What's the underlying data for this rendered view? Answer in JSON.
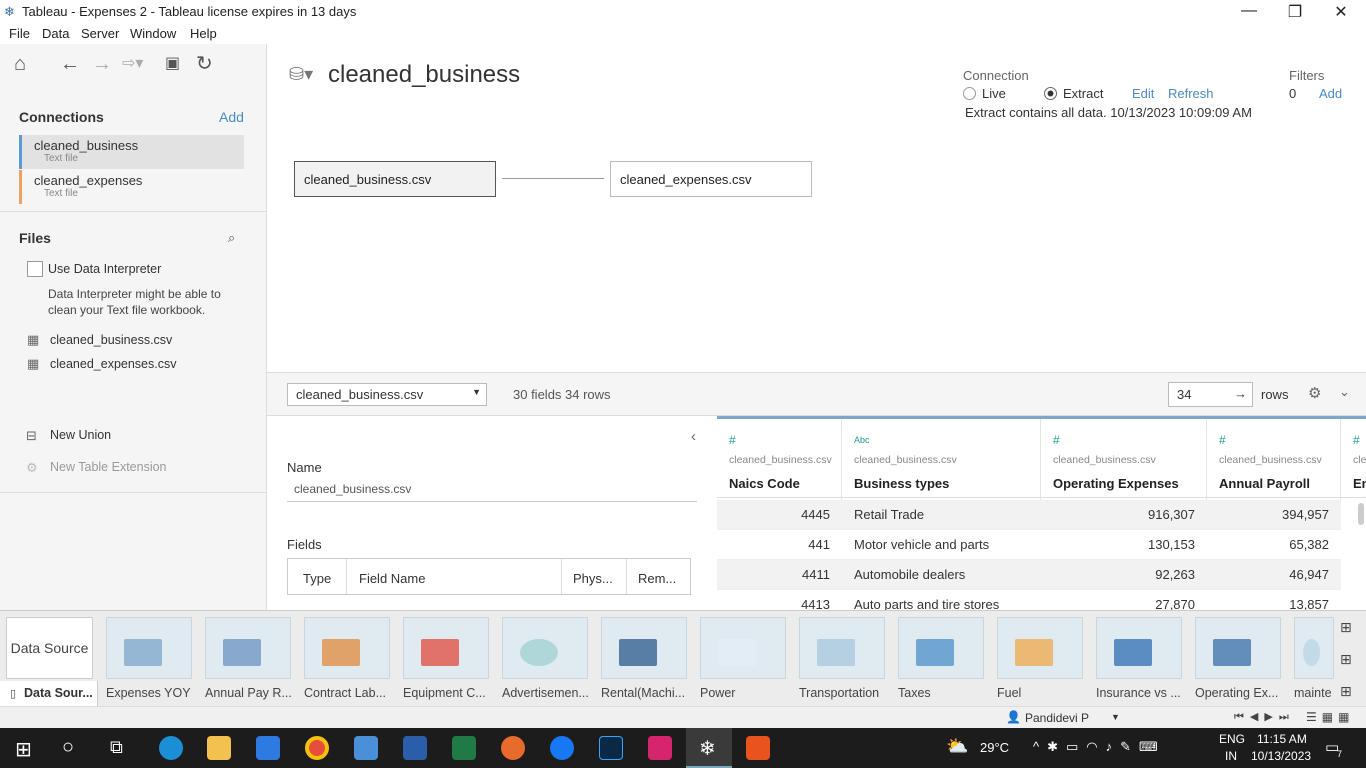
{
  "window": {
    "title": "Tableau - Expenses 2 - Tableau license expires in 13 days"
  },
  "menu": [
    "File",
    "Data",
    "Server",
    "Window",
    "Help"
  ],
  "left": {
    "connections_title": "Connections",
    "add_label": "Add",
    "connections": [
      {
        "name": "cleaned_business",
        "type": "Text file",
        "color": "#5b9bd5"
      },
      {
        "name": "cleaned_expenses",
        "type": "Text file",
        "color": "#f0a35e"
      }
    ],
    "files_title": "Files",
    "interpreter_label": "Use Data Interpreter",
    "interpreter_hint": "Data Interpreter might be able to clean your Text file workbook.",
    "files": [
      "cleaned_business.csv",
      "cleaned_expenses.csv"
    ],
    "new_union": "New Union",
    "new_table_ext": "New Table Extension"
  },
  "canvas": {
    "datasource_name": "cleaned_business",
    "connection_label": "Connection",
    "live_label": "Live",
    "extract_label": "Extract",
    "edit_label": "Edit",
    "refresh_label": "Refresh",
    "extract_info": "Extract contains all data. 10/13/2023 10:09:09 AM",
    "filters_label": "Filters",
    "filters_count": "0",
    "filters_add": "Add",
    "tables": [
      "cleaned_business.csv",
      "cleaned_expenses.csv"
    ]
  },
  "gridbar": {
    "selected_table": "cleaned_business.csv",
    "summary": "30 fields 34 rows",
    "rows_value": "34",
    "rows_label": "rows"
  },
  "meta": {
    "name_label": "Name",
    "name_value": "cleaned_business.csv",
    "fields_label": "Fields",
    "columns": [
      "Type",
      "Field Name",
      "Phys...",
      "Rem..."
    ]
  },
  "grid": {
    "columns": [
      {
        "icon": "#",
        "source": "cleaned_business.csv",
        "header": "Naics Code"
      },
      {
        "icon": "Abc",
        "source": "cleaned_business.csv",
        "header": "Business types"
      },
      {
        "icon": "#",
        "source": "cleaned_business.csv",
        "header": "Operating Expenses"
      },
      {
        "icon": "#",
        "source": "cleaned_business.csv",
        "header": "Annual Payroll"
      },
      {
        "icon": "#",
        "source": "cle",
        "header": "En"
      }
    ],
    "rows": [
      [
        "4445",
        "Retail Trade",
        "916,307",
        "394,957"
      ],
      [
        "441",
        "Motor vehicle and parts",
        "130,153",
        "65,382"
      ],
      [
        "4411",
        "Automobile dealers",
        "92,263",
        "46,947"
      ],
      [
        "4413",
        "Auto parts and tire stores",
        "27,870",
        "13,857"
      ]
    ]
  },
  "sheets": {
    "data_source_btn": "Data Source",
    "tabs": [
      "Data Sour...",
      "Expenses YOY",
      "Annual Pay R...",
      "Contract Lab...",
      "Equipment C...",
      "Advertisemen...",
      "Rental(Machi...",
      "Power",
      "Transportation",
      "Taxes",
      "Fuel",
      "Insurance vs ...",
      "Operating Ex...",
      "mainte"
    ]
  },
  "status": {
    "user": "Pandidevi P"
  },
  "taskbar": {
    "weather": "29°C",
    "lang1": "ENG",
    "lang2": "IN",
    "time": "11:15 AM",
    "date": "10/13/2023",
    "notif": "7"
  }
}
